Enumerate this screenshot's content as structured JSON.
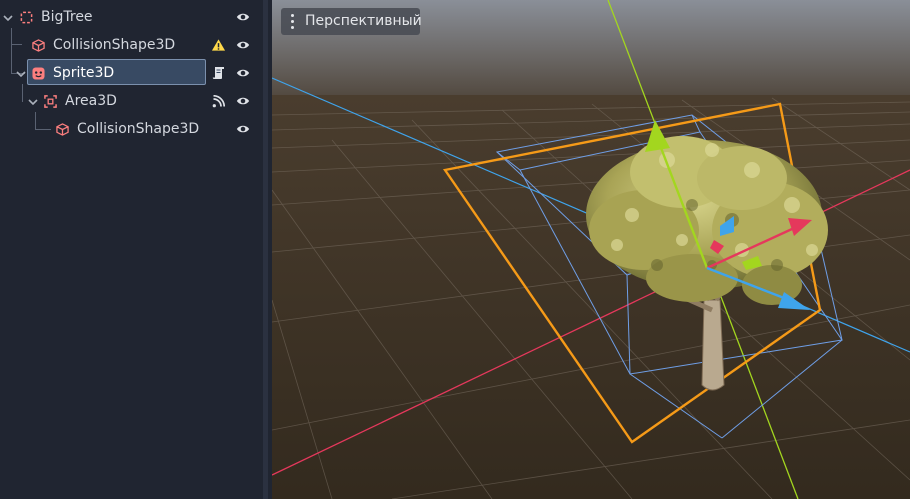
{
  "scene_tree": {
    "nodes": [
      {
        "label": "BigTree",
        "type_icon": "node3d-icon",
        "status_icons": [
          "eye-icon"
        ]
      },
      {
        "label": "CollisionShape3D",
        "type_icon": "collision-shape-icon",
        "status_icons": [
          "warning-icon",
          "eye-icon"
        ]
      },
      {
        "label": "Sprite3D",
        "type_icon": "sprite3d-icon",
        "status_icons": [
          "script-icon",
          "eye-icon"
        ],
        "selected": true
      },
      {
        "label": "Area3D",
        "type_icon": "area3d-icon",
        "status_icons": [
          "signal-icon",
          "eye-icon"
        ]
      },
      {
        "label": "CollisionShape3D",
        "type_icon": "collision-shape-icon",
        "status_icons": [
          "eye-icon"
        ]
      }
    ]
  },
  "viewport": {
    "perspective_label": "Перспективный"
  },
  "colors": {
    "panel_bg": "#202531",
    "selection_bg": "#384a63",
    "accent_red": "#fc7f7f",
    "x_axis": "#e5385c",
    "y_axis": "#a3d61f",
    "z_axis": "#3fa4ec",
    "gizmo_orange": "#f59a18",
    "collision_wire": "#6f9ee6",
    "warning": "#ffd94a"
  }
}
